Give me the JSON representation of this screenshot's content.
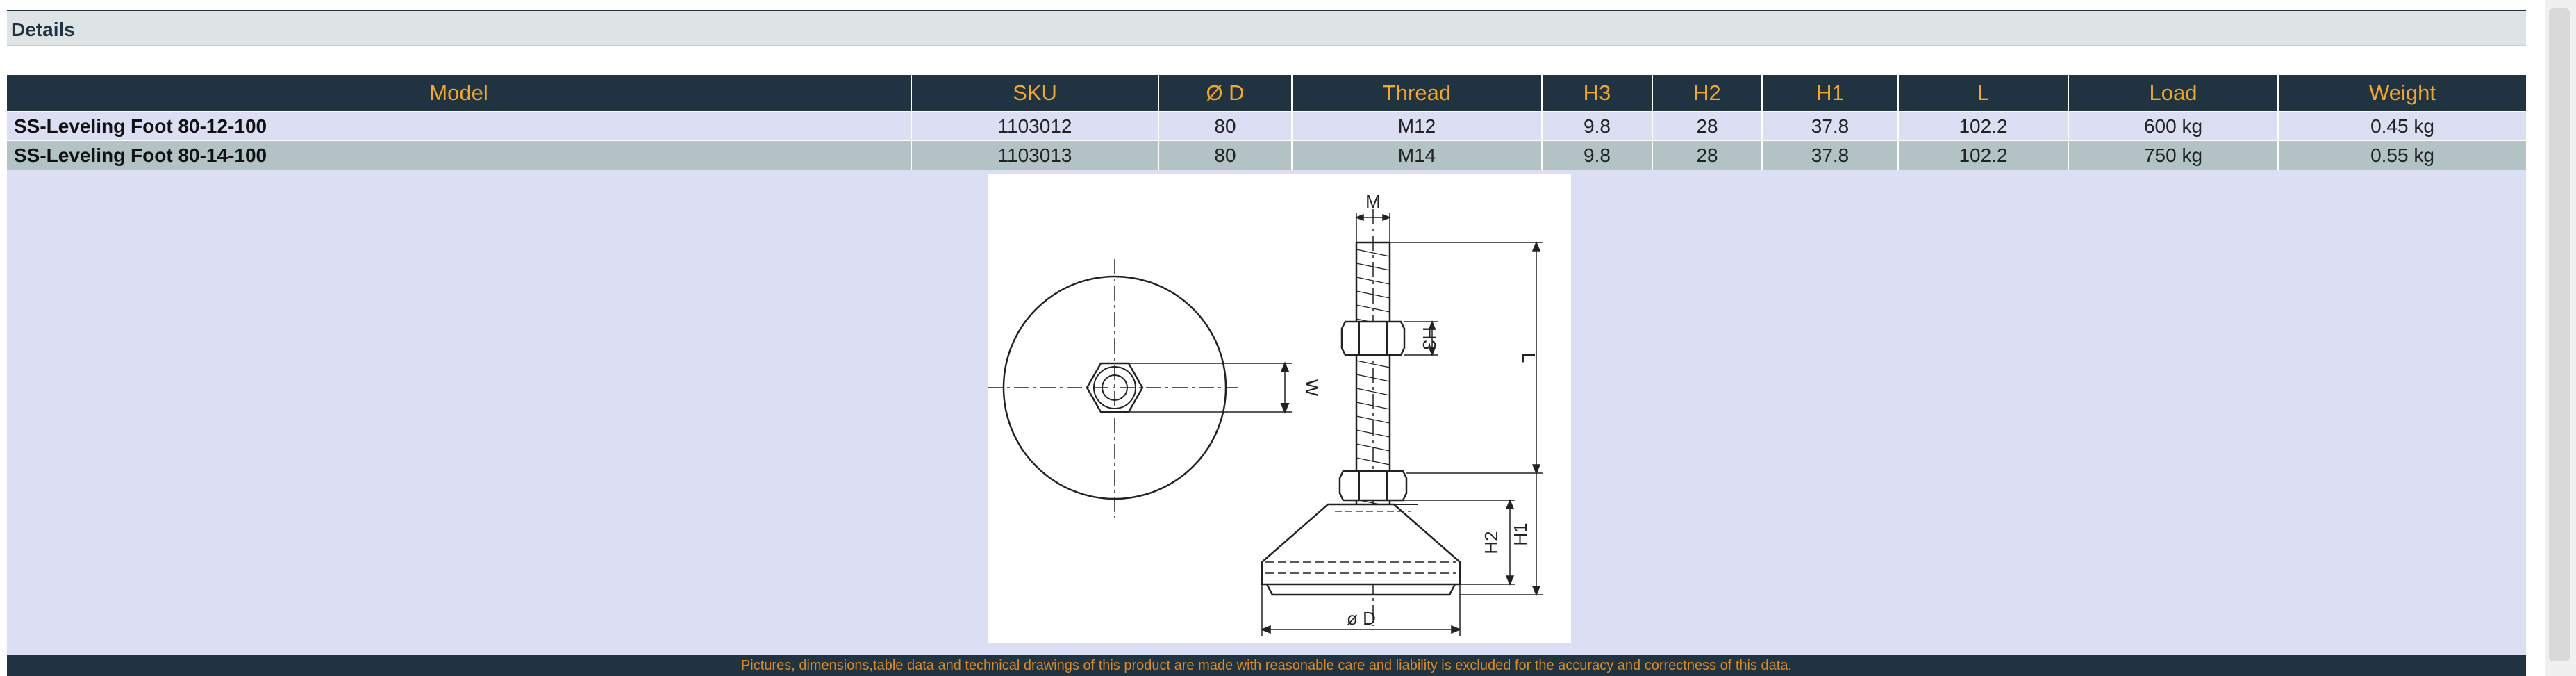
{
  "section": {
    "title": "Details"
  },
  "table": {
    "headers": [
      "Model",
      "SKU",
      "Ø D",
      "Thread",
      "H3",
      "H2",
      "H1",
      "L",
      "Load",
      "Weight"
    ],
    "rows": [
      [
        "SS-Leveling Foot 80-12-100",
        "1103012",
        "80",
        "M12",
        "9.8",
        "28",
        "37.8",
        "102.2",
        "600 kg",
        "0.45 kg"
      ],
      [
        "SS-Leveling Foot 80-14-100",
        "1103013",
        "80",
        "M14",
        "9.8",
        "28",
        "37.8",
        "102.2",
        "750 kg",
        "0.55 kg"
      ]
    ]
  },
  "drawing": {
    "labels": {
      "m": "M",
      "w": "W",
      "h3": "H3",
      "l": "L",
      "h2": "H2",
      "h1": "H1",
      "d": "ø D"
    }
  },
  "footer": {
    "disclaimer": "Pictures, dimensions,table data and technical drawings of this product are made with reasonable care and liability is excluded for the accuracy and correctness of this data."
  },
  "colors": {
    "header_bg": "#1f3340",
    "header_text": "#f5a623",
    "row_light": "#dcdff3",
    "row_dark": "#b3c3c5",
    "footer_text": "#e08a1e"
  }
}
